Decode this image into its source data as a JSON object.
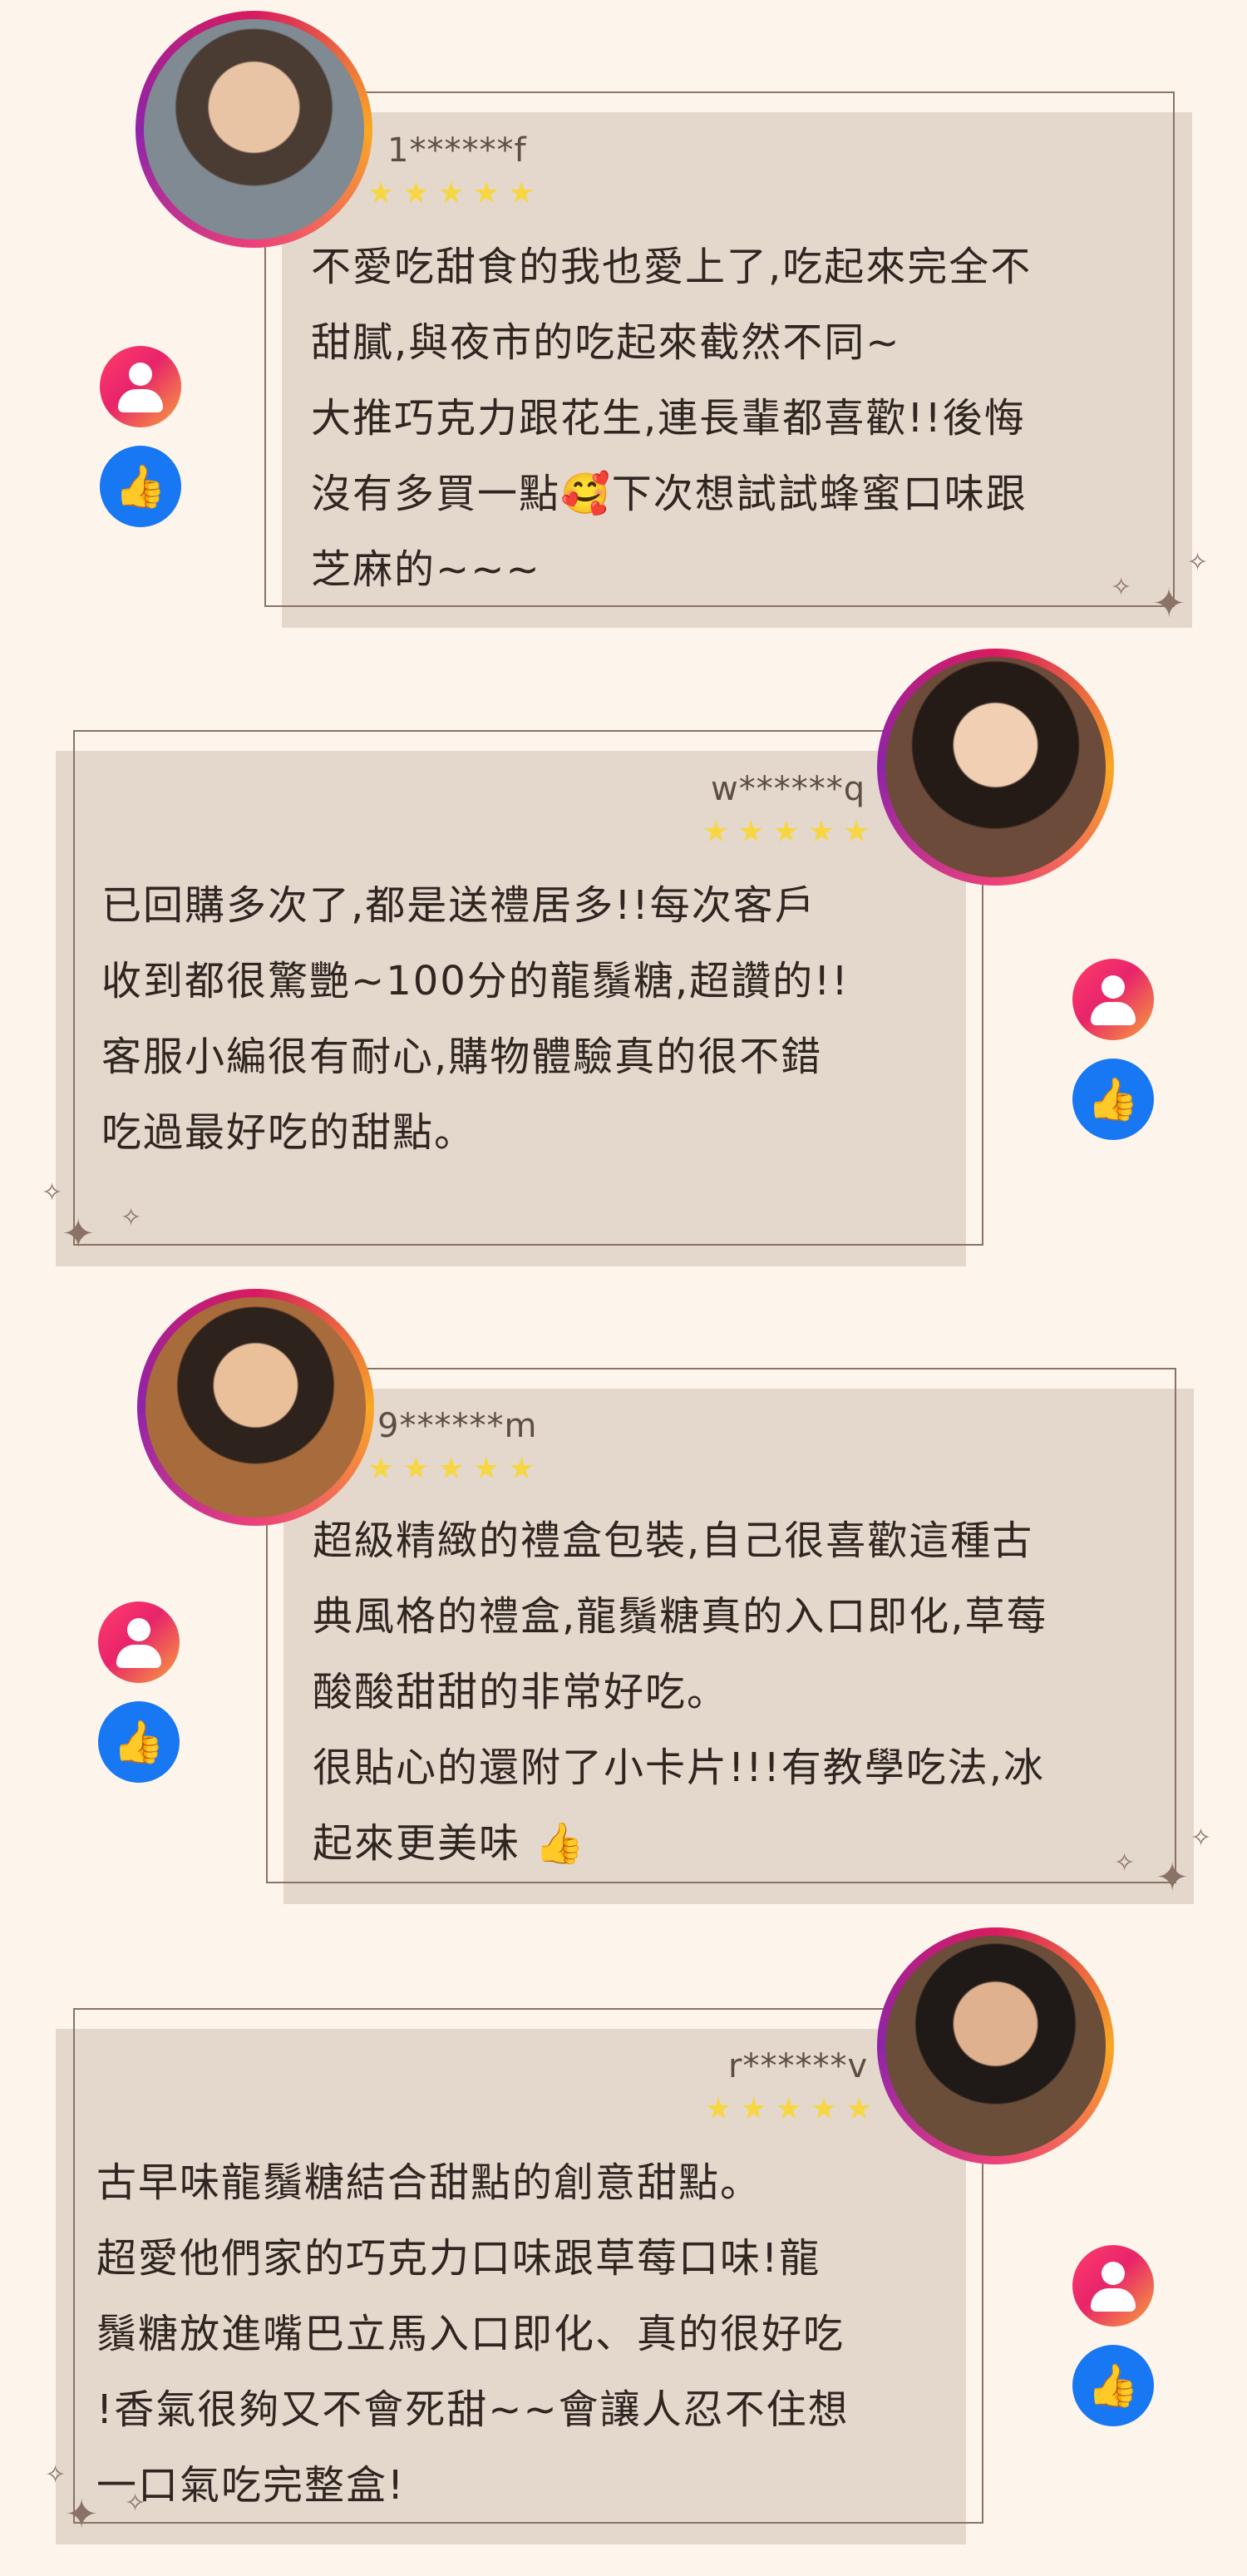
{
  "reviews": [
    {
      "user": "1******f",
      "stars": "★★★★★",
      "text": "不愛吃甜食的我也愛上了,吃起來完全不\n甜膩,與夜市的吃起來截然不同~\n大推巧克力跟花生,連長輩都喜歡!!後悔\n沒有多買一點🥰下次想試試蜂蜜口味跟\n芝麻的~~~"
    },
    {
      "user": "w******q",
      "stars": "★★★★★",
      "text": "已回購多次了,都是送禮居多!!每次客戶\n收到都很驚艷~100分的龍鬚糖,超讚的!!\n客服小編很有耐心,購物體驗真的很不錯\n吃過最好吃的甜點。"
    },
    {
      "user": "9******m",
      "stars": "★★★★★",
      "text": "超級精緻的禮盒包裝,自己很喜歡這種古\n典風格的禮盒,龍鬚糖真的入口即化,草莓\n酸酸甜甜的非常好吃。\n很貼心的還附了小卡片!!!有教學吃法,冰\n起來更美味 👍"
    },
    {
      "user": "r******v",
      "stars": "★★★★★",
      "text": "古早味龍鬚糖結合甜點的創意甜點。\n超愛他們家的巧克力口味跟草莓口味!龍\n鬚糖放進嘴巴立馬入口即化、真的很好吃\n!香氣很夠又不會死甜~~會讓人忍不住想\n一口氣吃完整盒!"
    }
  ],
  "icons": {
    "profile": "profile-icon",
    "like": "thumbs-up-icon",
    "like_glyph": "👍"
  }
}
